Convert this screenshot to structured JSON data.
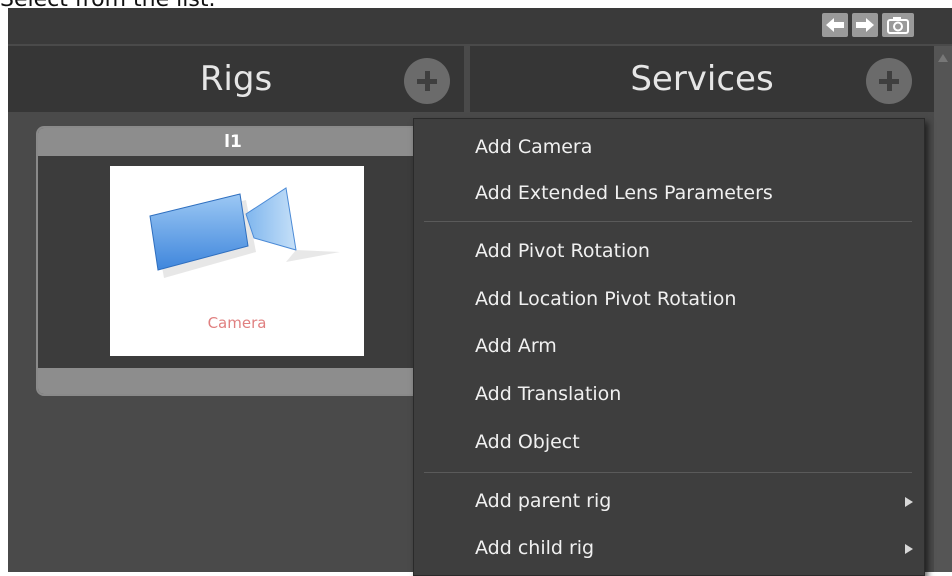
{
  "caption": "Select from the list.",
  "toolbar": {
    "back_icon": "arrow-left-icon",
    "forward_icon": "arrow-right-icon",
    "snapshot_icon": "camera-icon"
  },
  "rigs_panel": {
    "title": "Rigs",
    "add_icon": "plus-circle-icon",
    "card": {
      "title": "l1",
      "thumbnail_label": "Camera",
      "thumbnail_icon": "video-camera-icon"
    }
  },
  "services_panel": {
    "title": "Services",
    "add_icon": "plus-circle-icon"
  },
  "context_menu": {
    "groups": [
      [
        "Add Camera",
        "Add Extended Lens Parameters"
      ],
      [
        "Add Pivot Rotation",
        "Add Location Pivot Rotation",
        "Add Arm",
        "Add Translation",
        "Add Object"
      ],
      [
        "Add parent rig",
        "Add child rig"
      ]
    ],
    "items": {
      "add_camera": "Add Camera",
      "add_extended_lens": "Add Extended Lens Parameters",
      "add_pivot_rotation": "Add Pivot Rotation",
      "add_location_pivot_rotation": "Add Location Pivot Rotation",
      "add_arm": "Add Arm",
      "add_translation": "Add Translation",
      "add_object": "Add Object",
      "add_parent_rig": "Add parent rig",
      "add_child_rig": "Add child rig"
    }
  },
  "colors": {
    "panel_bg": "#4a4a4a",
    "header_bg": "#363636",
    "menu_bg": "#3e3e3e",
    "card_accent": "#8d8d8d",
    "thumbnail_label": "#e08080",
    "camera_blue": "#5aa0e8"
  }
}
